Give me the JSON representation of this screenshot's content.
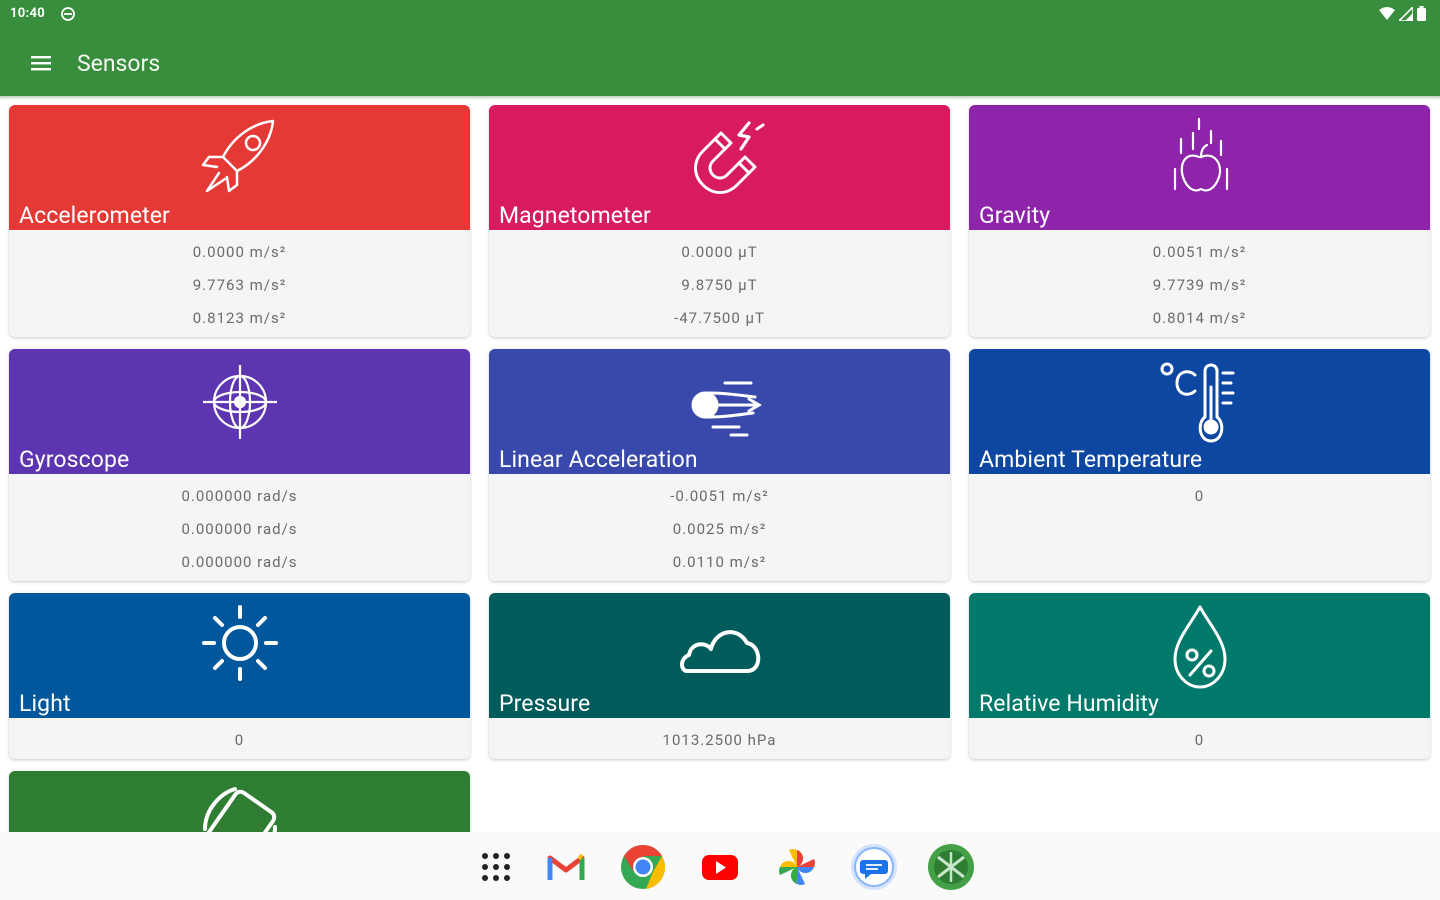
{
  "status": {
    "time": "10:40"
  },
  "appbar": {
    "title": "Sensors"
  },
  "sensors": [
    {
      "name": "Accelerometer",
      "color": "#e53935",
      "icon": "rocket-icon",
      "values": [
        "0.0000 m/s²",
        "9.7763 m/s²",
        "0.8123 m/s²"
      ]
    },
    {
      "name": "Magnetometer",
      "color": "#d81b60",
      "icon": "magnet-icon",
      "values": [
        "0.0000 µT",
        "9.8750 µT",
        "-47.7500 µT"
      ]
    },
    {
      "name": "Gravity",
      "color": "#8e24aa",
      "icon": "falling-apple-icon",
      "values": [
        "0.0051 m/s²",
        "9.7739 m/s²",
        "0.8014 m/s²"
      ]
    },
    {
      "name": "Gyroscope",
      "color": "#5e35b1",
      "icon": "gyroscope-icon",
      "values": [
        "0.000000 rad/s",
        "0.000000 rad/s",
        "0.000000 rad/s"
      ]
    },
    {
      "name": "Linear Acceleration",
      "color": "#3949ab",
      "icon": "speed-ball-icon",
      "values": [
        "-0.0051 m/s²",
        "0.0025 m/s²",
        "0.0110 m/s²"
      ]
    },
    {
      "name": "Ambient Temperature",
      "color": "#0d47a1",
      "icon": "thermometer-icon",
      "values": [
        "0"
      ]
    },
    {
      "name": "Light",
      "color": "#01579b",
      "icon": "sun-icon",
      "values": [
        "0"
      ]
    },
    {
      "name": "Pressure",
      "color": "#005b5b",
      "icon": "cloud-icon",
      "values": [
        "1013.2500 hPa"
      ]
    },
    {
      "name": "Relative Humidity",
      "color": "#00796b",
      "icon": "humidity-drop-icon",
      "values": [
        "0"
      ]
    },
    {
      "name": "",
      "color": "#2e7d32",
      "icon": "rotation-icon",
      "values": []
    }
  ],
  "dock": [
    {
      "name": "app-drawer",
      "icon": "grid-icon"
    },
    {
      "name": "gmail",
      "icon": "gmail-icon"
    },
    {
      "name": "chrome",
      "icon": "chrome-icon"
    },
    {
      "name": "youtube",
      "icon": "youtube-icon"
    },
    {
      "name": "photos",
      "icon": "photos-icon"
    },
    {
      "name": "messages",
      "icon": "messages-icon"
    },
    {
      "name": "sensors-app",
      "icon": "sensors-app-icon"
    }
  ]
}
